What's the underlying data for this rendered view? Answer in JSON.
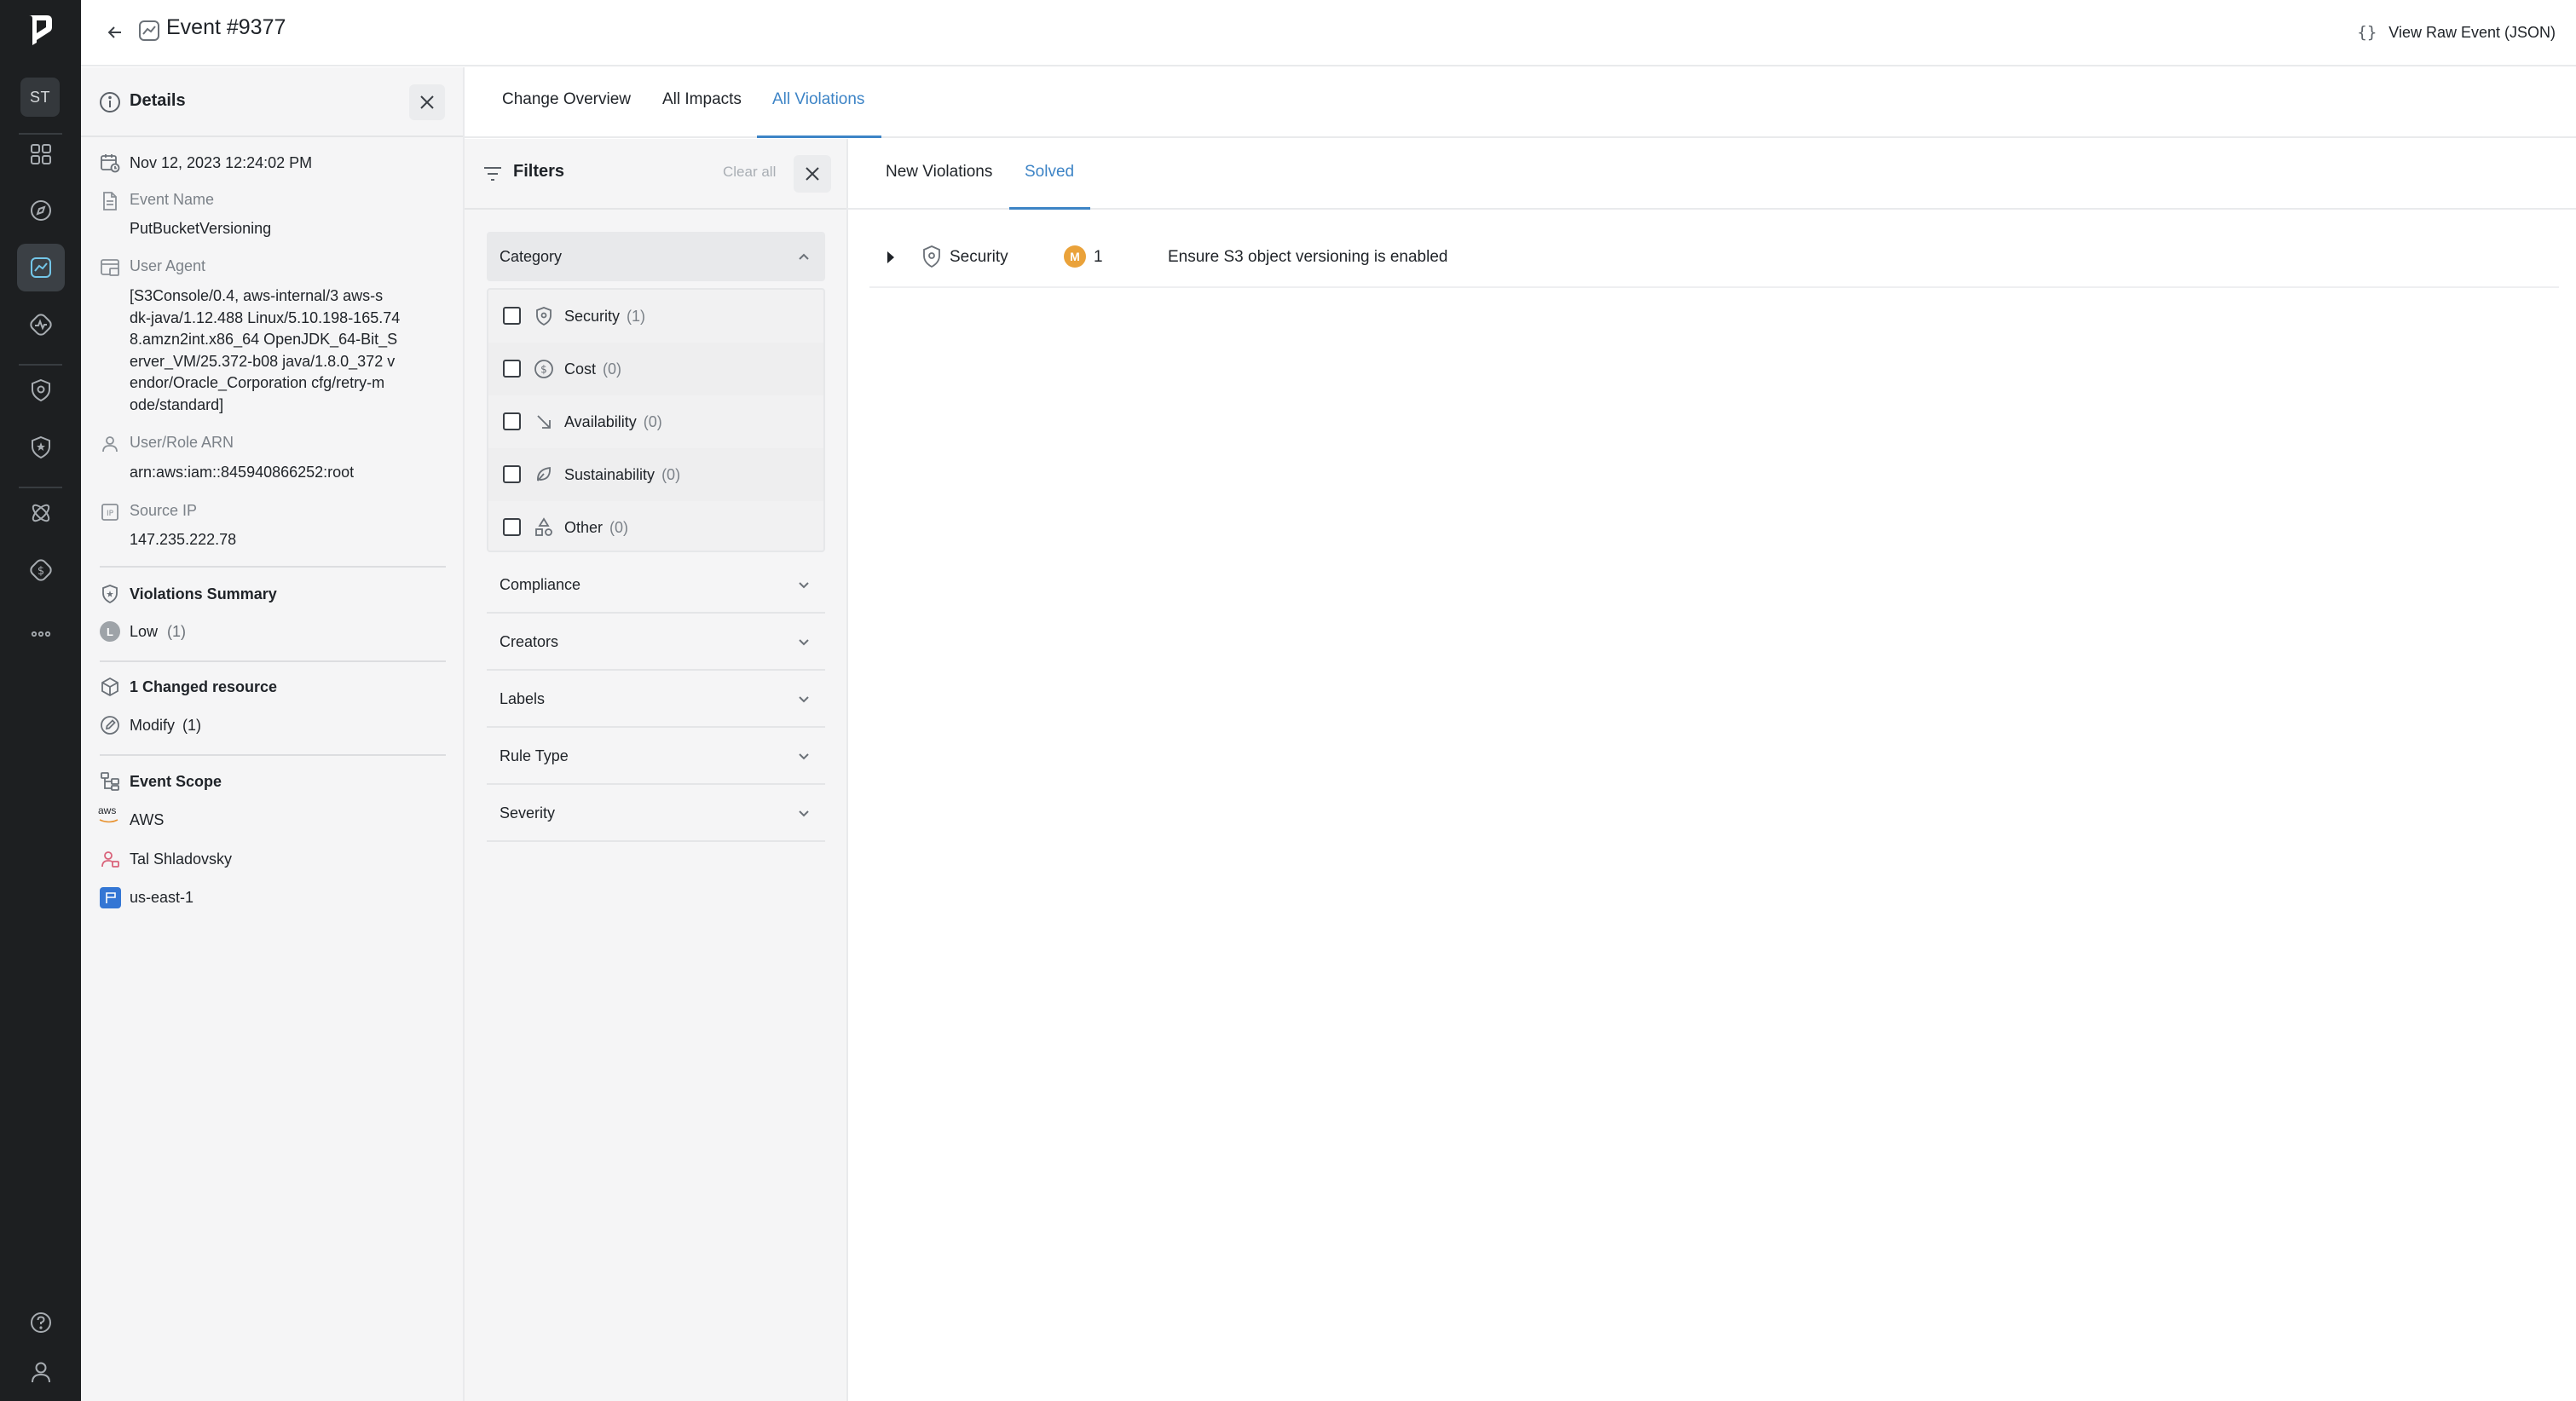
{
  "header": {
    "title": "Event #9377",
    "raw_button_icon": "{}",
    "raw_button_label": "View Raw Event (JSON)"
  },
  "rail": {
    "avatar": "ST",
    "items": [
      "dashboard-icon",
      "compass-icon",
      "events-icon",
      "activity-icon",
      "shield-icon",
      "shield-star-icon",
      "atom-icon",
      "dollar-icon",
      "more-icon"
    ],
    "active": "events-icon",
    "bottom": [
      "help-icon",
      "user-icon"
    ]
  },
  "details": {
    "title": "Details",
    "timestamp": "Nov 12, 2023 12:24:02 PM",
    "event_name_label": "Event Name",
    "event_name": "PutBucketVersioning",
    "user_agent_label": "User Agent",
    "user_agent_lines": [
      "[S3Console/0.4, aws-internal/3 aws-s",
      "dk-java/1.12.488 Linux/5.10.198-165.74",
      "8.amzn2int.x86_64 OpenJDK_64-Bit_S",
      "erver_VM/25.372-b08 java/1.8.0_372 v",
      "endor/Oracle_Corporation cfg/retry-m",
      "ode/standard]"
    ],
    "arn_label": "User/Role ARN",
    "arn": "arn:aws:iam::845940866252:root",
    "source_ip_label": "Source IP",
    "source_ip": "147.235.222.78",
    "violations_summary_label": "Violations Summary",
    "severity_badge": "L",
    "severity_name": "Low",
    "severity_count": "(1)",
    "changed_resource": "1 Changed resource",
    "modify_name": "Modify",
    "modify_count": "(1)",
    "scope_label": "Event Scope",
    "provider_logo": "aws",
    "provider": "AWS",
    "account": "Tal Shladovsky",
    "region": "us-east-1"
  },
  "tabs": {
    "items": [
      "Change Overview",
      "All Impacts",
      "All Violations"
    ],
    "active": "All Violations"
  },
  "filters": {
    "title": "Filters",
    "clear_all": "Clear all",
    "category_title": "Category",
    "categories": [
      {
        "label": "Security",
        "count": "(1)",
        "icon": "shield-icon"
      },
      {
        "label": "Cost",
        "count": "(0)",
        "icon": "dollar-icon"
      },
      {
        "label": "Availability",
        "count": "(0)",
        "icon": "arrow-down-right-icon"
      },
      {
        "label": "Sustainability",
        "count": "(0)",
        "icon": "leaf-icon"
      },
      {
        "label": "Other",
        "count": "(0)",
        "icon": "shapes-icon"
      }
    ],
    "sections": [
      "Compliance",
      "Creators",
      "Labels",
      "Rule Type",
      "Severity"
    ]
  },
  "violation_tabs": {
    "items": [
      "New Violations",
      "Solved"
    ],
    "active": "Solved"
  },
  "violations": [
    {
      "category": "Security",
      "severity_badge": "M",
      "severity_color": "#eaa23a",
      "count": "1",
      "rule": "Ensure S3 object versioning is enabled"
    }
  ],
  "colors": {
    "accent": "#3d84c6",
    "rail_bg": "#1d1f21",
    "panel_bg": "#f5f5f6",
    "medium_severity": "#eaa23a"
  }
}
